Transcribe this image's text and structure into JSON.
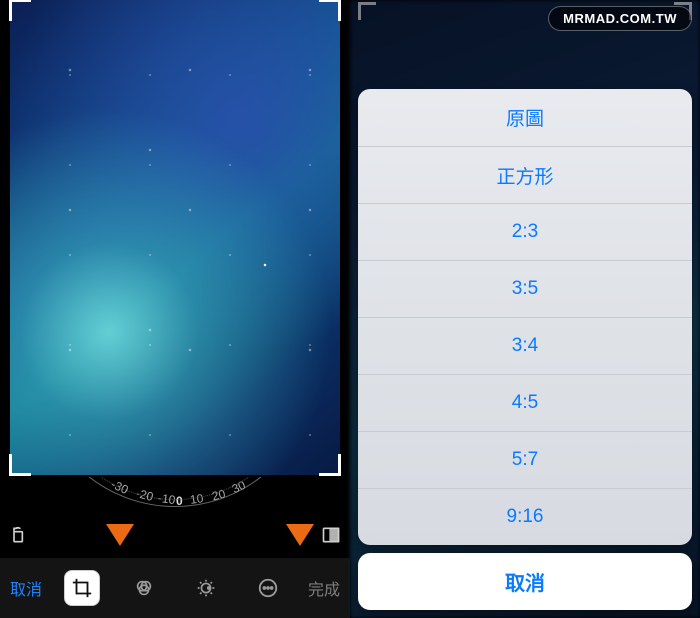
{
  "watermark": {
    "text": "MRMAD.COM.TW"
  },
  "left": {
    "dial": {
      "n1": "-30",
      "n2": "-20",
      "n3": "-10",
      "n4": "0",
      "n5": "10",
      "n6": "20",
      "n7": "30"
    },
    "toolbar": {
      "cancel": "取消",
      "done": "完成"
    },
    "icons": {
      "rotate": "rotate-icon",
      "aspect": "aspect-ratio-icon",
      "crop": "crop-icon",
      "filters": "filters-icon",
      "light": "light-adjust-icon",
      "more": "more-icon"
    }
  },
  "right": {
    "sheet": {
      "options": [
        "原圖",
        "正方形",
        "2:3",
        "3:5",
        "3:4",
        "4:5",
        "5:7",
        "9:16"
      ],
      "cancel": "取消"
    }
  }
}
